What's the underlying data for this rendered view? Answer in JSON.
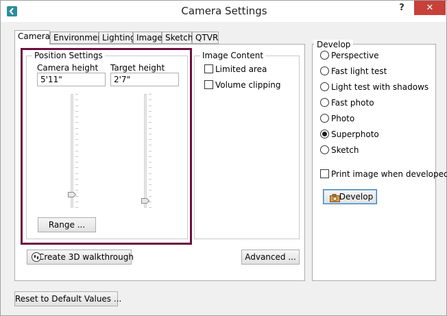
{
  "window": {
    "title": "Camera Settings",
    "help_glyph": "?",
    "close_glyph": "✕"
  },
  "tabs": [
    "Camera",
    "Environment",
    "Lighting",
    "Image",
    "Sketch",
    "QTVR"
  ],
  "active_tab": "Camera",
  "position_settings": {
    "legend": "Position Settings",
    "camera_height_label": "Camera height",
    "camera_height_value": "5'11\"",
    "target_height_label": "Target height",
    "target_height_value": "2'7\"",
    "camera_slider_level": 0.13,
    "target_slider_level": 0.08,
    "range_button": "Range ..."
  },
  "image_content": {
    "legend": "Image Content",
    "limited_area": "Limited area",
    "limited_area_checked": false,
    "volume_clipping": "Volume clipping",
    "volume_clipping_checked": false
  },
  "buttons": {
    "walkthrough": "Create 3D walkthrough",
    "advanced": "Advanced ...",
    "reset": "Reset to Default Values ..."
  },
  "develop": {
    "legend": "Develop",
    "options": [
      "Perspective",
      "Fast light test",
      "Light test with shadows",
      "Fast photo",
      "Photo",
      "Superphoto",
      "Sketch"
    ],
    "selected": "Superphoto",
    "print_label": "Print image when developed",
    "print_checked": false,
    "develop_button": "Develop"
  },
  "colors": {
    "highlight_border": "#6b0f3e",
    "close_button": "#c7403a",
    "app_icon": "#2c8c9c"
  },
  "icons": {
    "app": "back-arrow-icon",
    "walkthrough": "footprints-icon",
    "develop": "camera-icon"
  }
}
